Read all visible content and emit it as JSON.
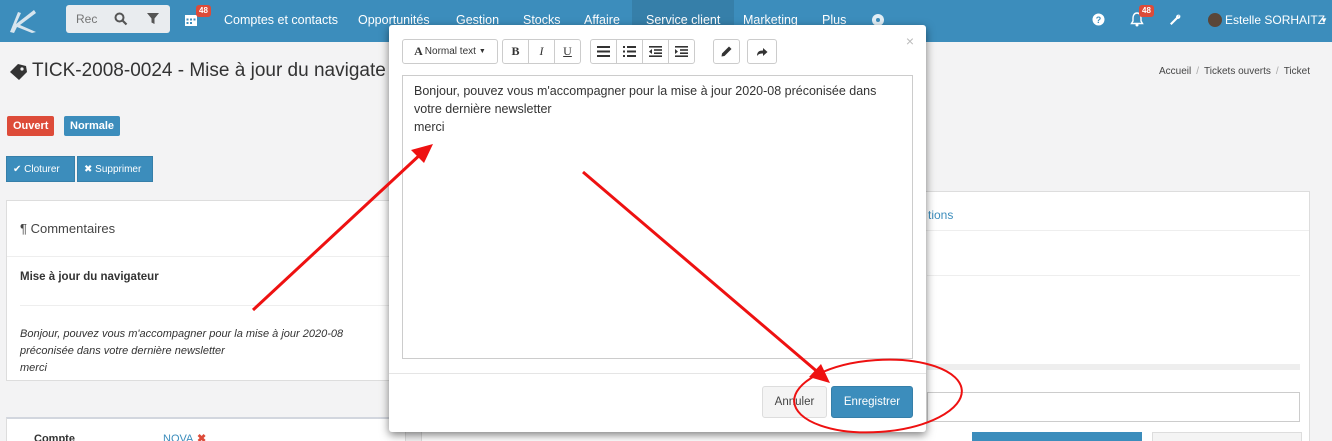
{
  "navbar": {
    "search_placeholder": "Rec",
    "calendar_badge": "48",
    "items": [
      {
        "label": "Comptes et contacts"
      },
      {
        "label": "Opportunités"
      },
      {
        "label": "Gestion"
      },
      {
        "label": "Stocks"
      },
      {
        "label": "Affaire"
      },
      {
        "label": "Service client"
      },
      {
        "label": "Marketing"
      },
      {
        "label": "Plus"
      }
    ],
    "notif_badge": "48",
    "user_name": "Estelle SORHAITZ"
  },
  "page": {
    "title": "TICK-2008-0024 - Mise à jour du navigate",
    "breadcrumb": [
      "Accueil",
      "Tickets ouverts",
      "Ticket"
    ],
    "status_label": "Ouvert",
    "priority_label": "Normale",
    "close_button": "Cloturer",
    "delete_button": "Supprimer",
    "comments_header": "Commentaires",
    "comment_title": "Mise à jour du navigateur",
    "comment_lines": [
      "Bonjour, pouvez vous m'accompagner pour la mise à jour 2020-08",
      "préconisée dans votre dernière newsletter",
      "merci"
    ],
    "right_tab_fragment": "tions",
    "account_label": "Compte",
    "account_value": "NOVA"
  },
  "modal": {
    "close": "×",
    "format_select": "Normal text",
    "editor_lines": [
      "Bonjour, pouvez vous m'accompagner pour la mise à jour 2020-08 préconisée dans",
      "votre dernière newsletter",
      "merci"
    ],
    "cancel_button": "Annuler",
    "save_button": "Enregistrer"
  },
  "colors": {
    "navbar": "#3c8dbc",
    "status_open": "#dd4b39",
    "priority_normal": "#3c8dbc",
    "annotation": "#ee1111"
  }
}
